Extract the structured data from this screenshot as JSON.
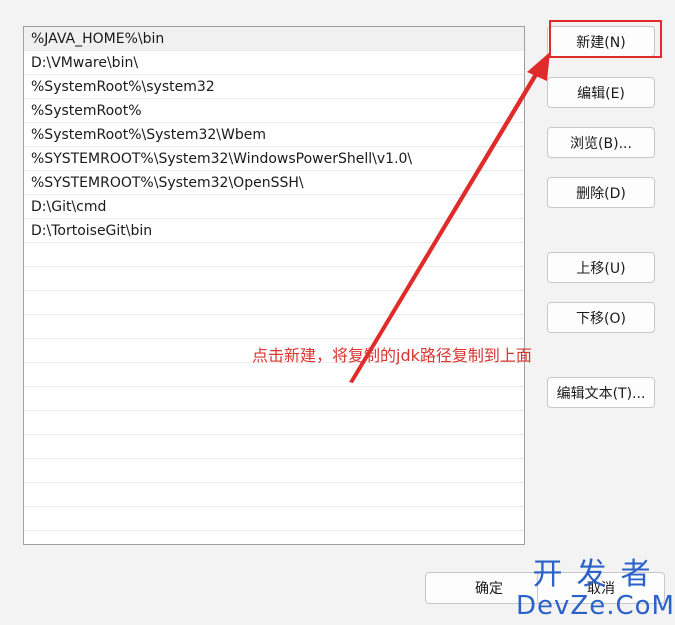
{
  "path_list": {
    "items": [
      "%JAVA_HOME%\\bin",
      "D:\\VMware\\bin\\",
      "%SystemRoot%\\system32",
      "%SystemRoot%",
      "%SystemRoot%\\System32\\Wbem",
      "%SYSTEMROOT%\\System32\\WindowsPowerShell\\v1.0\\",
      "%SYSTEMROOT%\\System32\\OpenSSH\\",
      "D:\\Git\\cmd",
      "D:\\TortoiseGit\\bin"
    ],
    "empty_rows": 12,
    "selected_index": 0
  },
  "buttons": {
    "new": "新建(N)",
    "edit": "编辑(E)",
    "browse": "浏览(B)...",
    "delete": "删除(D)",
    "move_up": "上移(U)",
    "move_down": "下移(O)",
    "edit_text": "编辑文本(T)...",
    "ok": "确定",
    "cancel": "取消"
  },
  "annotation": {
    "text": "点击新建，将复制的jdk路径复制到上面",
    "color": "#d9352f"
  },
  "watermark": {
    "cn": "开发者",
    "en": "DevZe.CoM"
  },
  "colors": {
    "accent_red": "#e02b2b",
    "watermark_blue": "#2a62c9"
  }
}
